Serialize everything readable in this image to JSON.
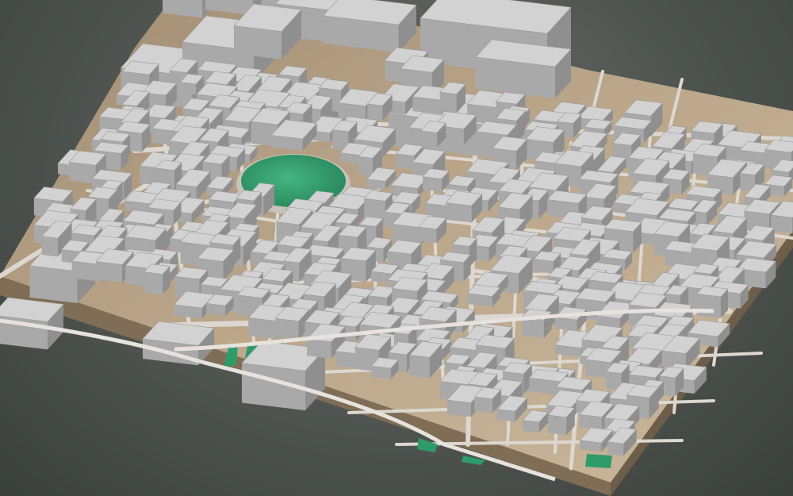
{
  "scene": {
    "description_type": "3d-city-block-model",
    "colors": {
      "background_top": "#6f736f",
      "background_bottom": "#3b403d",
      "terrain_top": "#b9a488",
      "terrain_side_front": "#7f6d55",
      "terrain_side_right": "#6e5e49",
      "street": "#d9d6d0",
      "building_roof": "#d2d2d2",
      "building_side": "#a9a9a9",
      "building_side_dark": "#8f8f8f",
      "park_green": "#2f9a6a",
      "park_green_light": "#45b482"
    },
    "features": {
      "round_park": "circular-green-park",
      "strip_parks": "green-strip-parks",
      "rail_line": "diagonal-rail-corridor"
    }
  }
}
